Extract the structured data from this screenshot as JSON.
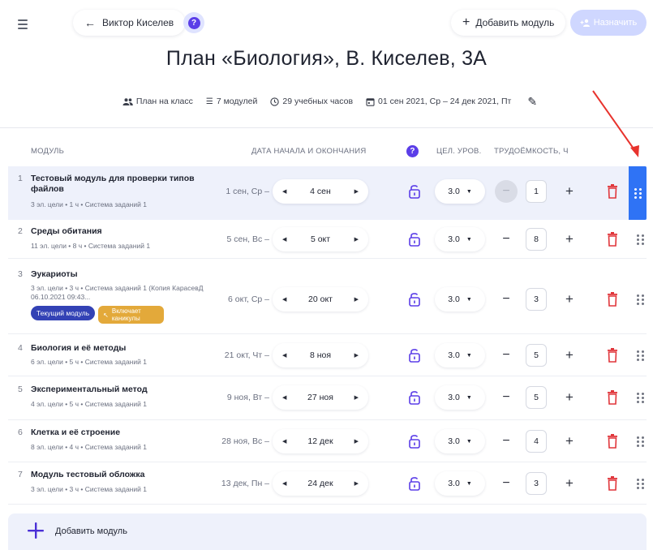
{
  "topbar": {
    "back_label": "Виктор Киселев",
    "help_label": "?",
    "add_module_label": "Добавить модуль",
    "assign_label": "Назначить",
    "assign_icon": "add-person-icon"
  },
  "title": "План «Биология», В. Киселев, 3А",
  "info": {
    "plan_type": "План на класс",
    "modules": "7 модулей",
    "hours": "29 учебных часов",
    "dates": "01 сен 2021, Ср – 24 дек 2021, Пт"
  },
  "table_head": {
    "module": "Модуль",
    "dates": "Дата начала и окончания",
    "level": "Цел. уров.",
    "effort": "Трудоёмкость, ч"
  },
  "rows": [
    {
      "num": "1",
      "title": "Тестовый модуль для проверки типов файлов",
      "meta": "3 эл. цели • 1 ч • Система заданий 1",
      "start": "1 сен, Ср –",
      "end": "4 сен",
      "level": "3.0",
      "hours": "1",
      "active": true
    },
    {
      "num": "2",
      "title": "Среды обитания",
      "meta": "11 эл. цели • 8 ч • Система заданий 1",
      "start": "5 сен, Вс –",
      "end": "5 окт",
      "level": "3.0",
      "hours": "8"
    },
    {
      "num": "3",
      "title": "Эукариоты",
      "meta": "3 эл. цели • 3 ч • Система заданий 1 (Копия КарасевД 06.10.2021 09:43...",
      "start": "6 окт, Ср –",
      "end": "20 окт",
      "level": "3.0",
      "hours": "3",
      "tag_current": "Текущий модуль",
      "tag_holidays": "Включает каникулы"
    },
    {
      "num": "4",
      "title": "Биология и её методы",
      "meta": "6 эл. цели • 5 ч • Система заданий 1",
      "start": "21 окт, Чт –",
      "end": "8 ноя",
      "level": "3.0",
      "hours": "5"
    },
    {
      "num": "5",
      "title": "Экспериментальный метод",
      "meta": "4 эл. цели • 5 ч • Система заданий 1",
      "start": "9 ноя, Вт –",
      "end": "27 ноя",
      "level": "3.0",
      "hours": "5"
    },
    {
      "num": "6",
      "title": "Клетка и её строение",
      "meta": "8 эл. цели • 4 ч • Система заданий 1",
      "start": "28 ноя, Вс –",
      "end": "12 дек",
      "level": "3.0",
      "hours": "4"
    },
    {
      "num": "7",
      "title": "Модуль тестовый обложка",
      "meta": "3 эл. цели • 3 ч • Система заданий 1",
      "start": "13 дек, Пн –",
      "end": "24 дек",
      "level": "3.0",
      "hours": "3"
    }
  ],
  "add_bar": {
    "label": "Добавить модуль"
  },
  "colors": {
    "accent": "#5b3ee8",
    "active_handle": "#2f73f5",
    "delete": "#e0353a",
    "current_tag": "#3342b5",
    "holiday_tag": "#e3a93a",
    "annotation_arrow": "#e8332d"
  }
}
